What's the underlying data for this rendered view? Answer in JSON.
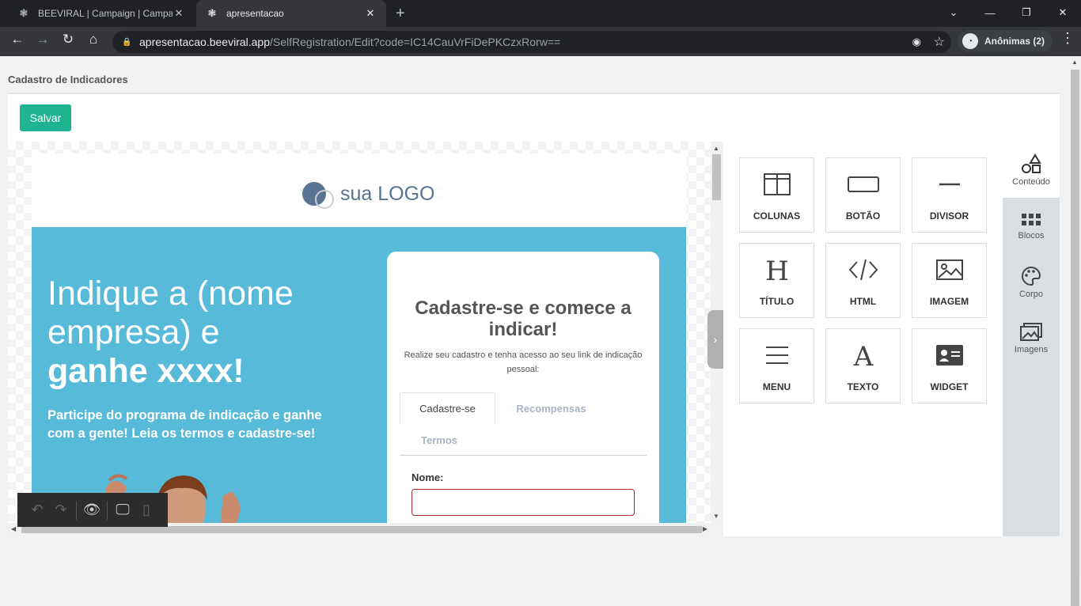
{
  "browser": {
    "tabs": [
      {
        "title": "BEEVIRAL | Campaign | Campaign",
        "active": false
      },
      {
        "title": "apresentacao",
        "active": true
      }
    ],
    "url": {
      "host": "apresentacao.beeviral.app",
      "path": "/SelfRegistration/Edit?code=IC14CauVrFiDePKCzxRorw=="
    },
    "profile": "Anônimas (2)"
  },
  "page": {
    "title": "Cadastro de Indicadores",
    "save_label": "Salvar"
  },
  "canvas": {
    "logo_text": "sua LOGO",
    "hero": {
      "title": "Indique a (nome empresa)  e",
      "title_bold": "ganhe xxxx!",
      "subtitle": "Participe do programa de indicação e ganhe com a gente! Leia os termos e cadastre-se!"
    },
    "form": {
      "title": "Cadastre-se e comece a indicar!",
      "description": "Realize seu cadastro e tenha acesso ao seu link de indicação pessoal:",
      "tabs": [
        "Cadastre-se",
        "Recompensas",
        "Termos"
      ],
      "name_label": "Nome:"
    }
  },
  "content_blocks": [
    {
      "label": "COLUNAS",
      "icon": "columns-icon"
    },
    {
      "label": "BOTÃO",
      "icon": "button-icon"
    },
    {
      "label": "DIVISOR",
      "icon": "divider-icon"
    },
    {
      "label": "TÍTULO",
      "icon": "heading-icon"
    },
    {
      "label": "HTML",
      "icon": "code-icon"
    },
    {
      "label": "IMAGEM",
      "icon": "image-icon"
    },
    {
      "label": "MENU",
      "icon": "menu-icon"
    },
    {
      "label": "TEXTO",
      "icon": "text-icon"
    },
    {
      "label": "WIDGET",
      "icon": "widget-icon"
    }
  ],
  "side_tabs": [
    {
      "label": "Conteúdo",
      "icon": "shapes-icon",
      "active": true
    },
    {
      "label": "Blocos",
      "icon": "grid-icon",
      "active": false
    },
    {
      "label": "Corpo",
      "icon": "palette-icon",
      "active": false
    },
    {
      "label": "Imagens",
      "icon": "images-icon",
      "active": false
    }
  ],
  "colors": {
    "save_button": "#1fb392",
    "hero_bg": "#58bad9",
    "logo": "#5a7393",
    "input_border": "#a52a2a"
  }
}
